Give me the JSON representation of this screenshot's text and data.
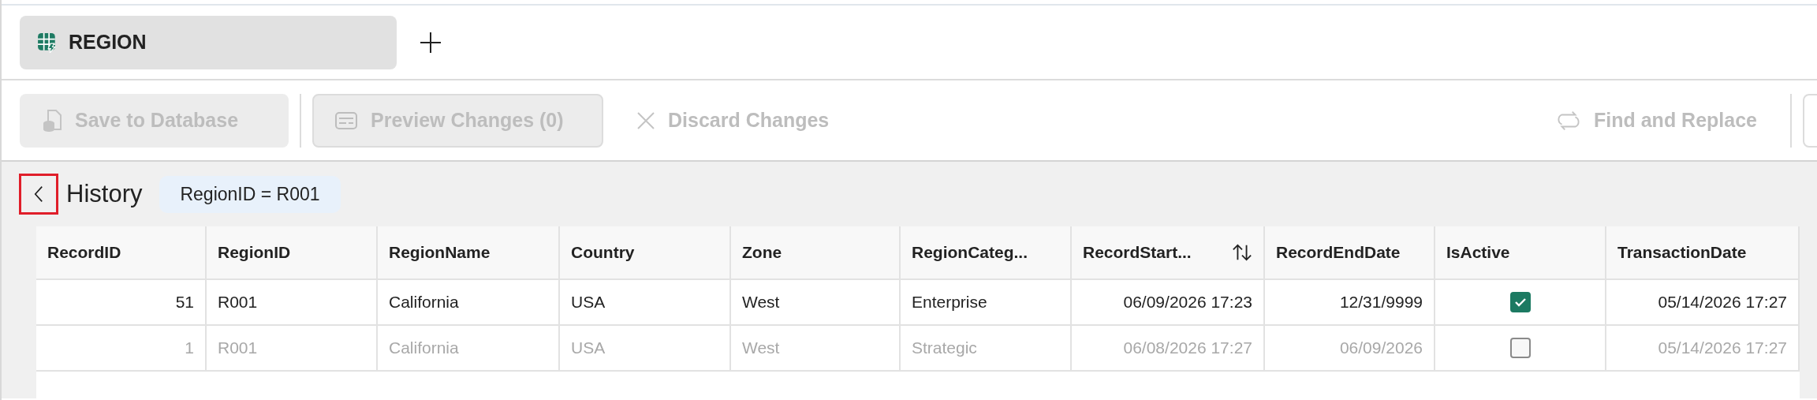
{
  "tabs": [
    {
      "label": "REGION",
      "selected": true
    }
  ],
  "toolbar": [
    {
      "kind": "filled",
      "label": "Save to Database",
      "disabled": true
    },
    {
      "kind": "outlined",
      "label": "Preview Changes (0)",
      "disabled": true
    },
    {
      "kind": "plain",
      "label": "Discard Changes",
      "disabled": true
    },
    {
      "kind": "plain",
      "label": "Find and Replace",
      "disabled": true
    }
  ],
  "history": {
    "back_highlighted": true,
    "title": "History",
    "filter": "RegionID = R001"
  },
  "table": {
    "columns": [
      {
        "label": "RecordID",
        "kind": "number",
        "sorted": false
      },
      {
        "label": "RegionID",
        "kind": "text",
        "sorted": false
      },
      {
        "label": "RegionName",
        "kind": "text",
        "sorted": false
      },
      {
        "label": "Country",
        "kind": "text",
        "sorted": false
      },
      {
        "label": "Zone",
        "kind": "text",
        "sorted": false
      },
      {
        "label": "RegionCateg...",
        "kind": "text",
        "sorted": false
      },
      {
        "label": "RecordStart...",
        "kind": "number",
        "sorted": true
      },
      {
        "label": "RecordEndDate",
        "kind": "number",
        "sorted": false
      },
      {
        "label": "IsActive",
        "kind": "check",
        "sorted": false
      },
      {
        "label": "TransactionDate",
        "kind": "number",
        "sorted": false
      }
    ],
    "rows": [
      {
        "greyed": false,
        "cells": [
          "51",
          "R001",
          "California",
          "USA",
          "West",
          "Enterprise",
          "06/09/2026 17:23",
          "12/31/9999",
          true,
          "05/14/2026 17:27"
        ]
      },
      {
        "greyed": true,
        "cells": [
          "1",
          "R001",
          "California",
          "USA",
          "West",
          "Strategic",
          "06/08/2026 17:27",
          "06/09/2026",
          false,
          "05/14/2026 17:27"
        ]
      }
    ]
  }
}
